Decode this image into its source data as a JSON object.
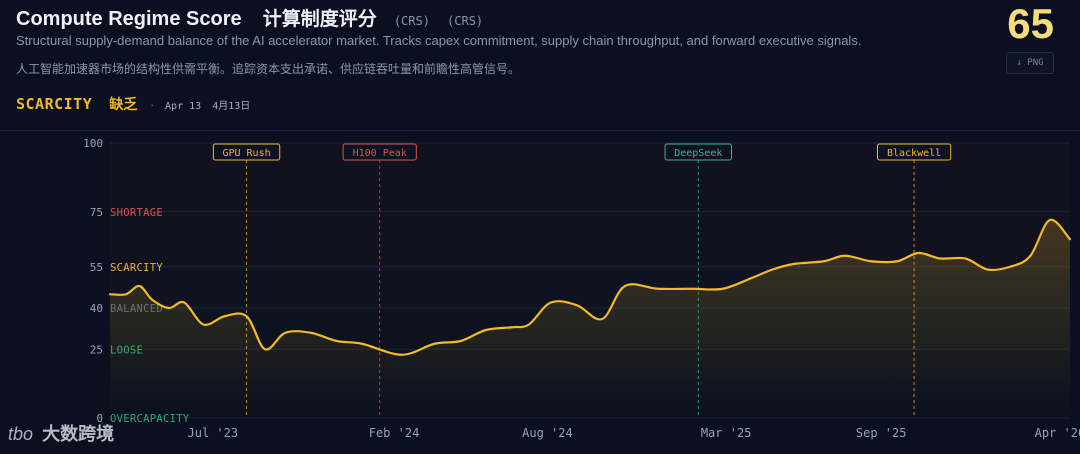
{
  "header": {
    "title_en": "Compute Regime Score",
    "title_zh": "计算制度评分",
    "abbr_1": "(CRS)",
    "abbr_2": "(CRS)",
    "description_en": "Structural supply-demand balance of the AI accelerator market. Tracks capex commitment, supply chain throughput, and forward executive signals.",
    "description_zh": "人工智能加速器市场的结构性供需平衡。追踪资本支出承诺、供应链吞吐量和前瞻性高管信号。",
    "status_en": "SCARCITY",
    "status_zh": "缺乏",
    "separator": "·",
    "date_en": "Apr 13",
    "date_zh": "4月13日",
    "score": "65",
    "png_button": "↓ PNG"
  },
  "watermark": {
    "logo": "tbo",
    "text": "大数跨境"
  },
  "colors": {
    "line": "#f2b928",
    "shortage": "#e0524d",
    "scarcity": "#e8b330",
    "balanced": "#5b6478",
    "loose": "#2fa86e",
    "overcapacity": "#2fa86e",
    "grid": "#1f2536",
    "axis_text": "#9aa1b3"
  },
  "chart_data": {
    "type": "line",
    "title": "",
    "xlabel": "",
    "ylabel": "",
    "ylim": [
      0,
      100
    ],
    "x_start": "2023-03-01",
    "x_end": "2026-04-13",
    "x_ticks": [
      {
        "date": "2023-07-01",
        "label": "Jul '23"
      },
      {
        "date": "2024-02-01",
        "label": "Feb '24"
      },
      {
        "date": "2024-08-01",
        "label": "Aug '24"
      },
      {
        "date": "2025-03-01",
        "label": "Mar '25"
      },
      {
        "date": "2025-09-01",
        "label": "Sep '25"
      },
      {
        "date": "2026-04-01",
        "label": "Apr '26"
      }
    ],
    "y_ticks": [
      0,
      25,
      40,
      55,
      75,
      100
    ],
    "zones": [
      {
        "label": "OVERCAPACITY",
        "at": 0,
        "color_key": "overcapacity"
      },
      {
        "label": "LOOSE",
        "at": 25,
        "color_key": "loose"
      },
      {
        "label": "BALANCED",
        "at": 40,
        "color_key": "balanced"
      },
      {
        "label": "SCARCITY",
        "at": 55,
        "color_key": "scarcity"
      },
      {
        "label": "SHORTAGE",
        "at": 75,
        "color_key": "shortage"
      }
    ],
    "events": [
      {
        "label": "GPU Rush",
        "date": "2023-08-10",
        "color": "#f2b928"
      },
      {
        "label": "H100 Peak",
        "date": "2024-01-15",
        "color": "#e0524d"
      },
      {
        "label": "DeepSeek",
        "date": "2025-01-27",
        "color": "#2fbf8a"
      },
      {
        "label": "Blackwell",
        "date": "2025-10-10",
        "color": "#f2b928"
      }
    ],
    "series": [
      {
        "values": [
          {
            "date": "2023-03-01",
            "y": 45
          },
          {
            "date": "2023-03-20",
            "y": 45
          },
          {
            "date": "2023-04-05",
            "y": 48
          },
          {
            "date": "2023-04-20",
            "y": 43
          },
          {
            "date": "2023-05-10",
            "y": 40
          },
          {
            "date": "2023-05-28",
            "y": 42
          },
          {
            "date": "2023-06-20",
            "y": 34
          },
          {
            "date": "2023-07-15",
            "y": 37
          },
          {
            "date": "2023-08-10",
            "y": 37
          },
          {
            "date": "2023-09-01",
            "y": 25
          },
          {
            "date": "2023-09-25",
            "y": 31
          },
          {
            "date": "2023-10-25",
            "y": 31
          },
          {
            "date": "2023-11-25",
            "y": 28
          },
          {
            "date": "2023-12-25",
            "y": 27
          },
          {
            "date": "2024-02-10",
            "y": 23
          },
          {
            "date": "2024-03-20",
            "y": 27
          },
          {
            "date": "2024-04-20",
            "y": 28
          },
          {
            "date": "2024-05-20",
            "y": 32
          },
          {
            "date": "2024-06-20",
            "y": 33
          },
          {
            "date": "2024-07-10",
            "y": 34
          },
          {
            "date": "2024-08-05",
            "y": 42
          },
          {
            "date": "2024-09-05",
            "y": 41
          },
          {
            "date": "2024-10-05",
            "y": 36
          },
          {
            "date": "2024-11-01",
            "y": 48
          },
          {
            "date": "2024-12-10",
            "y": 47
          },
          {
            "date": "2025-01-20",
            "y": 47
          },
          {
            "date": "2025-02-25",
            "y": 47
          },
          {
            "date": "2025-04-01",
            "y": 51
          },
          {
            "date": "2025-04-25",
            "y": 54
          },
          {
            "date": "2025-05-20",
            "y": 56
          },
          {
            "date": "2025-06-25",
            "y": 57
          },
          {
            "date": "2025-07-20",
            "y": 59
          },
          {
            "date": "2025-08-20",
            "y": 57
          },
          {
            "date": "2025-09-20",
            "y": 57
          },
          {
            "date": "2025-10-15",
            "y": 60
          },
          {
            "date": "2025-11-10",
            "y": 58
          },
          {
            "date": "2025-12-10",
            "y": 58
          },
          {
            "date": "2026-01-05",
            "y": 54
          },
          {
            "date": "2026-02-01",
            "y": 55
          },
          {
            "date": "2026-02-25",
            "y": 59
          },
          {
            "date": "2026-03-20",
            "y": 72
          },
          {
            "date": "2026-04-13",
            "y": 65
          }
        ]
      }
    ]
  }
}
